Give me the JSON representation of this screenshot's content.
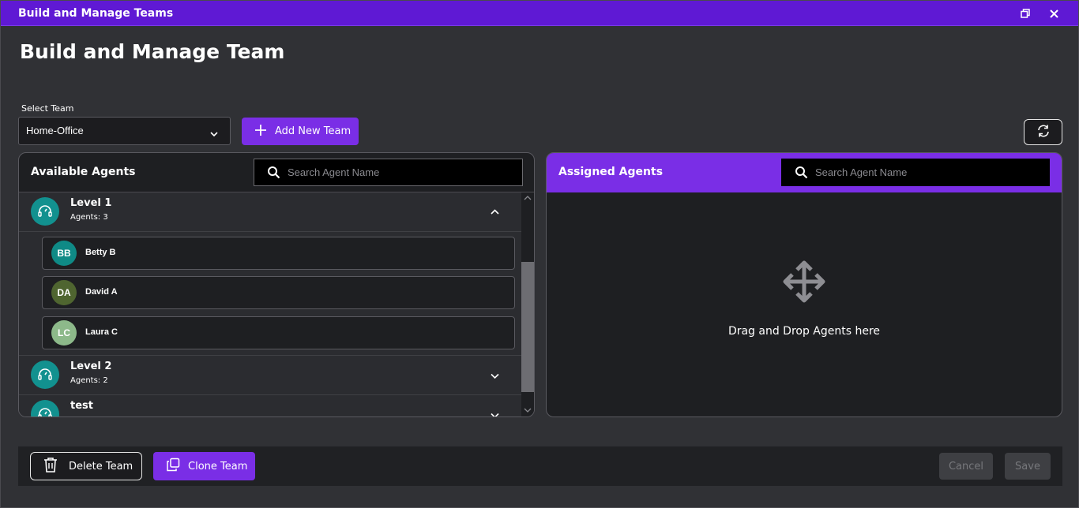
{
  "window": {
    "title": "Build and Manage Teams",
    "restore_icon": "restore-window-icon",
    "close_icon": "close-icon"
  },
  "page": {
    "title": "Build and Manage Team"
  },
  "team_select": {
    "label": "Select Team",
    "value": "Home-Office"
  },
  "add_team_button": {
    "label": "Add New Team",
    "icon": "plus-icon"
  },
  "refresh_button": {
    "icon": "refresh-icon"
  },
  "available": {
    "title": "Available Agents",
    "search_placeholder": "Search Agent Name",
    "levels": [
      {
        "name": "Level 1",
        "count_label": "Agents: 3",
        "expanded": true,
        "agents": [
          {
            "initials": "BB",
            "name": "Betty B",
            "color": "#0f8a86"
          },
          {
            "initials": "DA",
            "name": "David A",
            "color": "#4f6530"
          },
          {
            "initials": "LC",
            "name": "Laura C",
            "color": "#8db98a"
          }
        ]
      },
      {
        "name": "Level 2",
        "count_label": "Agents: 2",
        "expanded": false
      },
      {
        "name": "test",
        "count_label": "",
        "expanded": false
      }
    ]
  },
  "assigned": {
    "title": "Assigned Agents",
    "search_placeholder": "Search Agent Name",
    "empty_text": "Drag and Drop Agents here",
    "empty_icon": "move-arrows-icon"
  },
  "footer": {
    "delete_label": "Delete Team",
    "clone_label": "Clone Team",
    "cancel_label": "Cancel",
    "save_label": "Save"
  },
  "colors": {
    "accent": "#7a2ee6",
    "titlebar": "#5f19d4",
    "level_avatar": "#12918f"
  }
}
